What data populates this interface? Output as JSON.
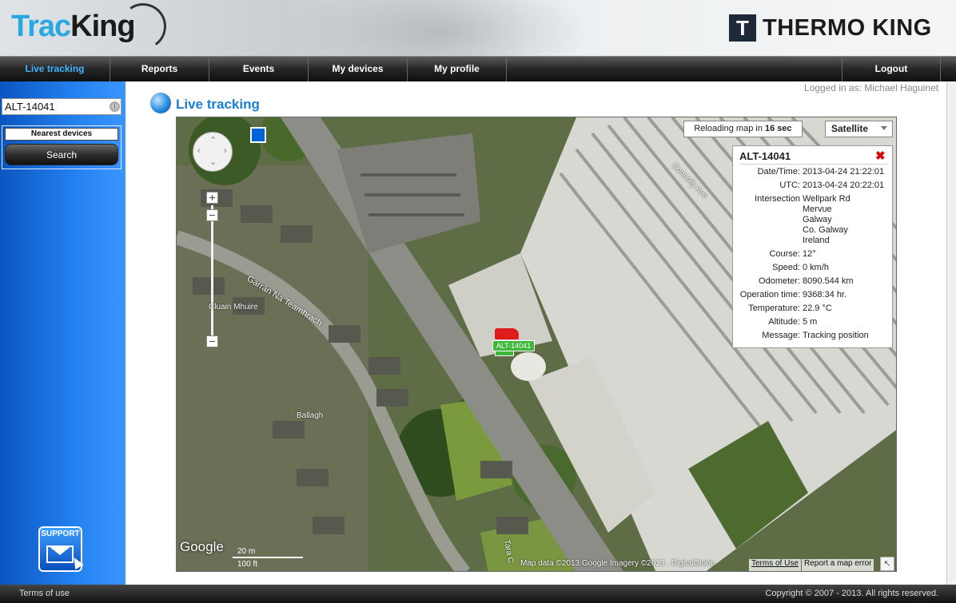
{
  "header": {
    "logo_part1": "Trac",
    "logo_part2": "King",
    "brand_badge": "T",
    "brand_name": "THERMO KING"
  },
  "nav": {
    "items": [
      {
        "label": "Live tracking"
      },
      {
        "label": "Reports"
      },
      {
        "label": "Events"
      },
      {
        "label": "My devices"
      },
      {
        "label": "My profile"
      }
    ],
    "logout": "Logout"
  },
  "sidebar": {
    "search_value": "ALT-14041",
    "nearest_label": "Nearest devices",
    "search_button": "Search",
    "support_label": "SUPPORT"
  },
  "logged_in": "Logged in as: Michael Haguinet",
  "page_title": "Live tracking",
  "map": {
    "reload_prefix": "Reloading map in",
    "reload_value": "16 sec",
    "map_type": "Satellite",
    "labels": {
      "road1": "Garrán Na Teamhrach",
      "place1": "Cluain Mhuire",
      "place2": "Ballagh",
      "road2": "Connolly Ave",
      "road3": "Tara C"
    },
    "google": "Google",
    "scale_m": "20 m",
    "scale_ft": "100 ft",
    "attribution": "Map data ©2013 Google Imagery ©2013 , DigitalGlobe",
    "terms": "Terms of Use",
    "report_error": "Report a map error",
    "vehicle_label": "ALT-14041"
  },
  "info_window": {
    "title": "ALT-14041",
    "rows": [
      {
        "key": "Date/Time:",
        "value": "2013-04-24 21:22:01"
      },
      {
        "key": "UTC:",
        "value": "2013-04-24 20:22:01"
      },
      {
        "key": "Intersection",
        "value": "Wellpark Rd"
      },
      {
        "key": "",
        "value": "Mervue"
      },
      {
        "key": "",
        "value": "Galway"
      },
      {
        "key": "",
        "value": "Co. Galway"
      },
      {
        "key": "",
        "value": "Ireland"
      },
      {
        "key": "Course:",
        "value": "12°"
      },
      {
        "key": "Speed:",
        "value": "0 km/h"
      },
      {
        "key": "Odometer:",
        "value": "8090.544 km"
      },
      {
        "key": "Operation time:",
        "value": "9368:34 hr."
      },
      {
        "key": "Temperature:",
        "value": "22.9 °C"
      },
      {
        "key": "Altitude:",
        "value": "5 m"
      },
      {
        "key": "Message:",
        "value": "Tracking position"
      }
    ]
  },
  "footer": {
    "terms": "Terms of use",
    "copyright": "Copyright © 2007 - 2013. All rights reserved."
  },
  "colors": {
    "accent": "#28a8e0",
    "nav_active": "#3fb3ff",
    "sidebar": "#1f78e8",
    "vehicle": "#e01b1b",
    "vehicle_label": "#3eb73c"
  }
}
